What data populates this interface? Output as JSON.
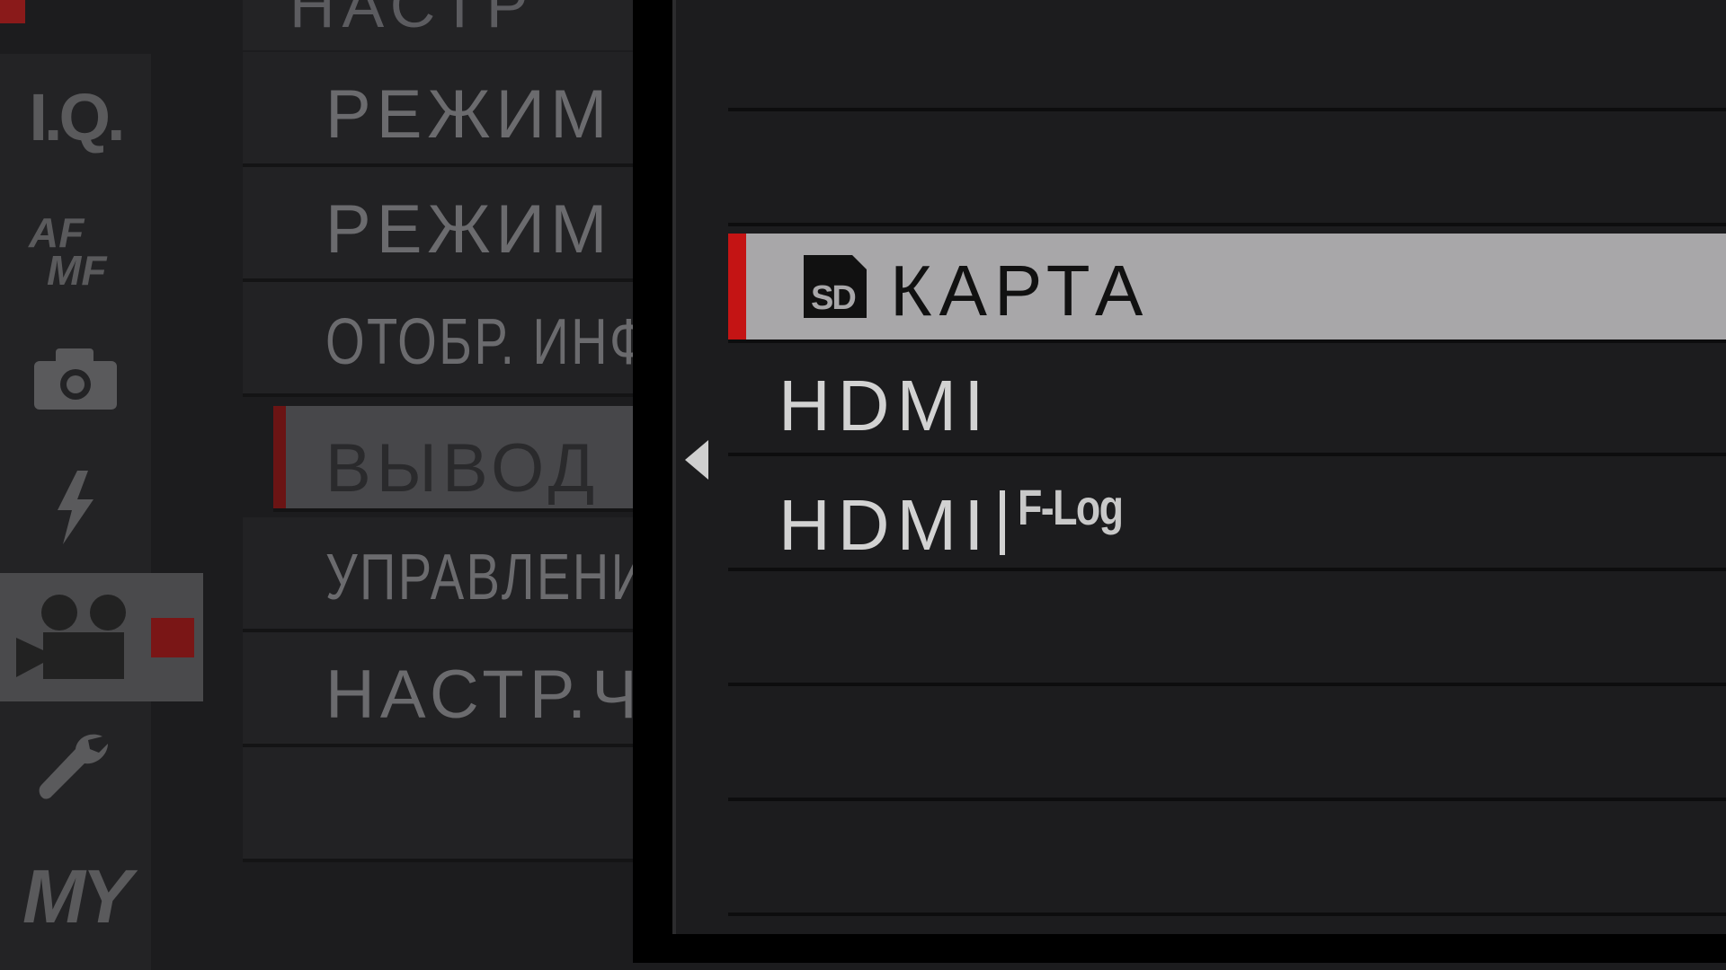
{
  "rail": {
    "iq_label": "I.Q.",
    "af_label": "AF",
    "mf_label": "MF",
    "my_label": "MY",
    "icons": [
      "camera-icon",
      "flash-icon",
      "movie-camera-icon",
      "wrench-icon"
    ],
    "active_item": "movie-camera-icon"
  },
  "menu": {
    "header": "НАСТР",
    "items": [
      {
        "label": "РЕЖИМ"
      },
      {
        "label": "РЕЖИМ A"
      },
      {
        "label": "ОТОБР. ИНФ"
      },
      {
        "label": "ВЫВОД"
      },
      {
        "label": "УПРАВЛЕНИ"
      },
      {
        "label": "НАСТР.Ч"
      }
    ],
    "selected_index": 3
  },
  "popup": {
    "options": [
      {
        "label": "КАРТА",
        "icon": "sd-card-icon",
        "selected": true
      },
      {
        "label": "HDMI",
        "selected": false
      },
      {
        "label": "HDMI",
        "tag": "F-Log",
        "selected": false
      }
    ]
  },
  "colors": {
    "accent_red": "#c41414",
    "selected_bg": "#a8a7a9",
    "menu_selected_bg": "#47474a"
  }
}
